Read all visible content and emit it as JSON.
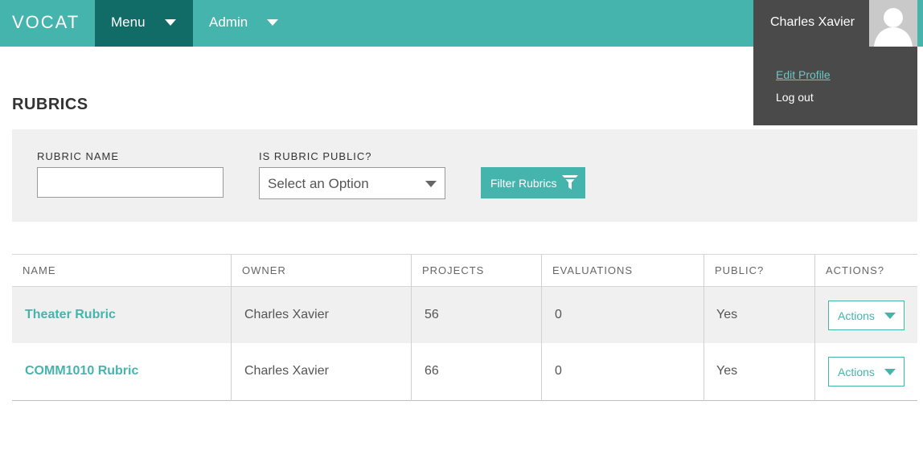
{
  "header": {
    "logo": "VOCAT",
    "menu_label": "Menu",
    "admin_label": "Admin",
    "user_name": "Charles Xavier",
    "user_menu": {
      "edit_profile": "Edit Profile",
      "log_out": "Log out"
    }
  },
  "page": {
    "title": "RUBRICS"
  },
  "filters": {
    "rubric_name_label": "RUBRIC NAME",
    "rubric_name_value": "",
    "public_label": "IS RUBRIC PUBLIC?",
    "public_selected": "Select an Option",
    "filter_button": "Filter Rubrics"
  },
  "table": {
    "headers": [
      "NAME",
      "OWNER",
      "PROJECTS",
      "EVALUATIONS",
      "PUBLIC?",
      "ACTIONS?"
    ],
    "rows": [
      {
        "name": "Theater Rubric",
        "owner": "Charles Xavier",
        "projects": "56",
        "evaluations": "0",
        "public": "Yes",
        "actions": "Actions"
      },
      {
        "name": "COMM1010 Rubric",
        "owner": "Charles Xavier",
        "projects": "66",
        "evaluations": "0",
        "public": "Yes",
        "actions": "Actions"
      }
    ]
  },
  "colors": {
    "brand_teal": "#45b4ad",
    "nav_active": "#116b66",
    "user_box": "#4a4a4a",
    "panel_bg": "#f0f0f0"
  },
  "icons": [
    "caret-down-icon",
    "user-avatar-icon",
    "filter-funnel-icon"
  ]
}
